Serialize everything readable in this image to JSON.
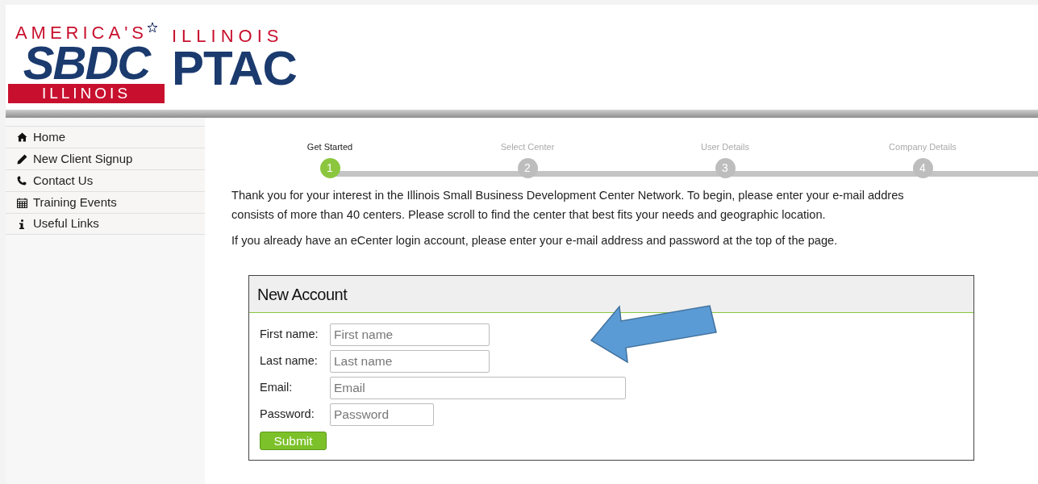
{
  "logo": {
    "sbdc_top": "AMERICA'S",
    "sbdc_main": "SBDC",
    "sbdc_band": "ILLINOIS",
    "ptac_top": "ILLINOIS",
    "ptac_main": "PTAC"
  },
  "sidebar": {
    "items": [
      {
        "label": "Home"
      },
      {
        "label": "New Client Signup"
      },
      {
        "label": "Contact Us"
      },
      {
        "label": "Training Events"
      },
      {
        "label": "Useful Links"
      }
    ]
  },
  "steps": [
    {
      "label": "Get Started",
      "number": "1",
      "selected": true
    },
    {
      "label": "Select Center",
      "number": "2",
      "selected": false
    },
    {
      "label": "User Details",
      "number": "3",
      "selected": false
    },
    {
      "label": "Company Details",
      "number": "4",
      "selected": false
    }
  ],
  "intro": [
    "Thank you for your interest in the Illinois Small Business Development Center Network. To begin, please enter your e-mail addres",
    "consists of more than 40 centers. Please scroll to find the center that best fits your needs and geographic location."
  ],
  "login_note": "If you already have an eCenter login account, please enter your e-mail address and password at the top of the page.",
  "form": {
    "title": "New Account",
    "fields": [
      {
        "label": "First name:",
        "placeholder": "First name"
      },
      {
        "label": "Last name:",
        "placeholder": "Last name"
      },
      {
        "label": "Email:",
        "placeholder": "Email"
      },
      {
        "label": "Password:",
        "placeholder": "Password"
      }
    ],
    "submit": "Submit"
  }
}
